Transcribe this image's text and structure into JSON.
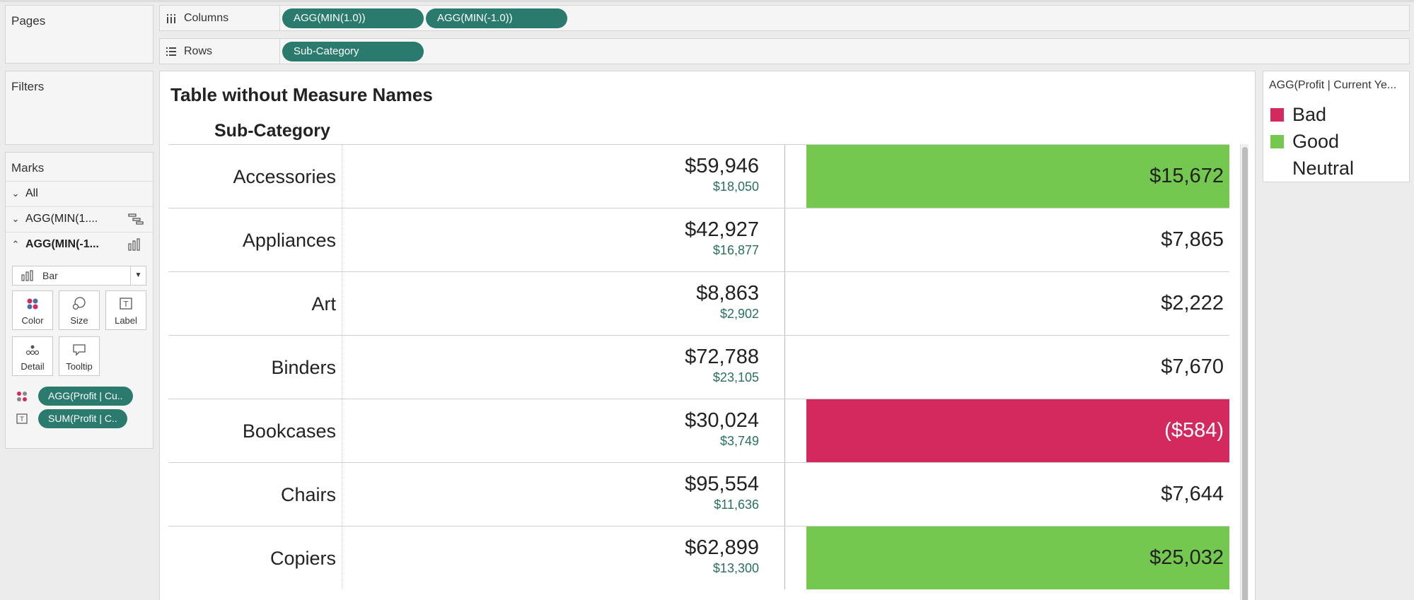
{
  "colors": {
    "pill": "#2b7a6e",
    "good": "#74c850",
    "bad": "#d4295e"
  },
  "pages": {
    "title": "Pages"
  },
  "filters": {
    "title": "Filters"
  },
  "marks": {
    "title": "Marks",
    "cards": [
      {
        "label": "All",
        "icon": "chevron-down-icon"
      },
      {
        "label": "AGG(MIN(1....",
        "icon": "gantt-icon"
      },
      {
        "label": "AGG(MIN(-1...",
        "icon": "bar-chart-icon"
      }
    ],
    "mark_type": "Bar",
    "buttons": {
      "color": "Color",
      "size": "Size",
      "label": "Label",
      "detail": "Detail",
      "tooltip": "Tooltip"
    },
    "fields": [
      {
        "label": "AGG(Profit | Cu..",
        "icon": "color-dots-icon"
      },
      {
        "label": "SUM(Profit | C..",
        "icon": "text-label-icon"
      }
    ]
  },
  "shelves": {
    "columns_label": "Columns",
    "columns": [
      "AGG(MIN(1.0))",
      "AGG(MIN(-1.0))"
    ],
    "rows_label": "Rows",
    "rows": [
      "Sub-Category"
    ]
  },
  "viz": {
    "title": "Table without Measure Names",
    "column_header": "Sub-Category",
    "rows": [
      {
        "category": "Accessories",
        "sales": "$59,946",
        "sub": "$18,050",
        "profit": "$15,672",
        "status": "good"
      },
      {
        "category": "Appliances",
        "sales": "$42,927",
        "sub": "$16,877",
        "profit": "$7,865",
        "status": "neutral"
      },
      {
        "category": "Art",
        "sales": "$8,863",
        "sub": "$2,902",
        "profit": "$2,222",
        "status": "neutral"
      },
      {
        "category": "Binders",
        "sales": "$72,788",
        "sub": "$23,105",
        "profit": "$7,670",
        "status": "neutral"
      },
      {
        "category": "Bookcases",
        "sales": "$30,024",
        "sub": "$3,749",
        "profit": "($584)",
        "status": "bad"
      },
      {
        "category": "Chairs",
        "sales": "$95,554",
        "sub": "$11,636",
        "profit": "$7,644",
        "status": "neutral"
      },
      {
        "category": "Copiers",
        "sales": "$62,899",
        "sub": "$13,300",
        "profit": "$25,032",
        "status": "good"
      }
    ]
  },
  "legend": {
    "title": "AGG(Profit | Current Ye...",
    "items": [
      {
        "label": "Bad",
        "color": "#d4295e"
      },
      {
        "label": "Good",
        "color": "#74c850"
      },
      {
        "label": "Neutral",
        "color": ""
      }
    ]
  }
}
